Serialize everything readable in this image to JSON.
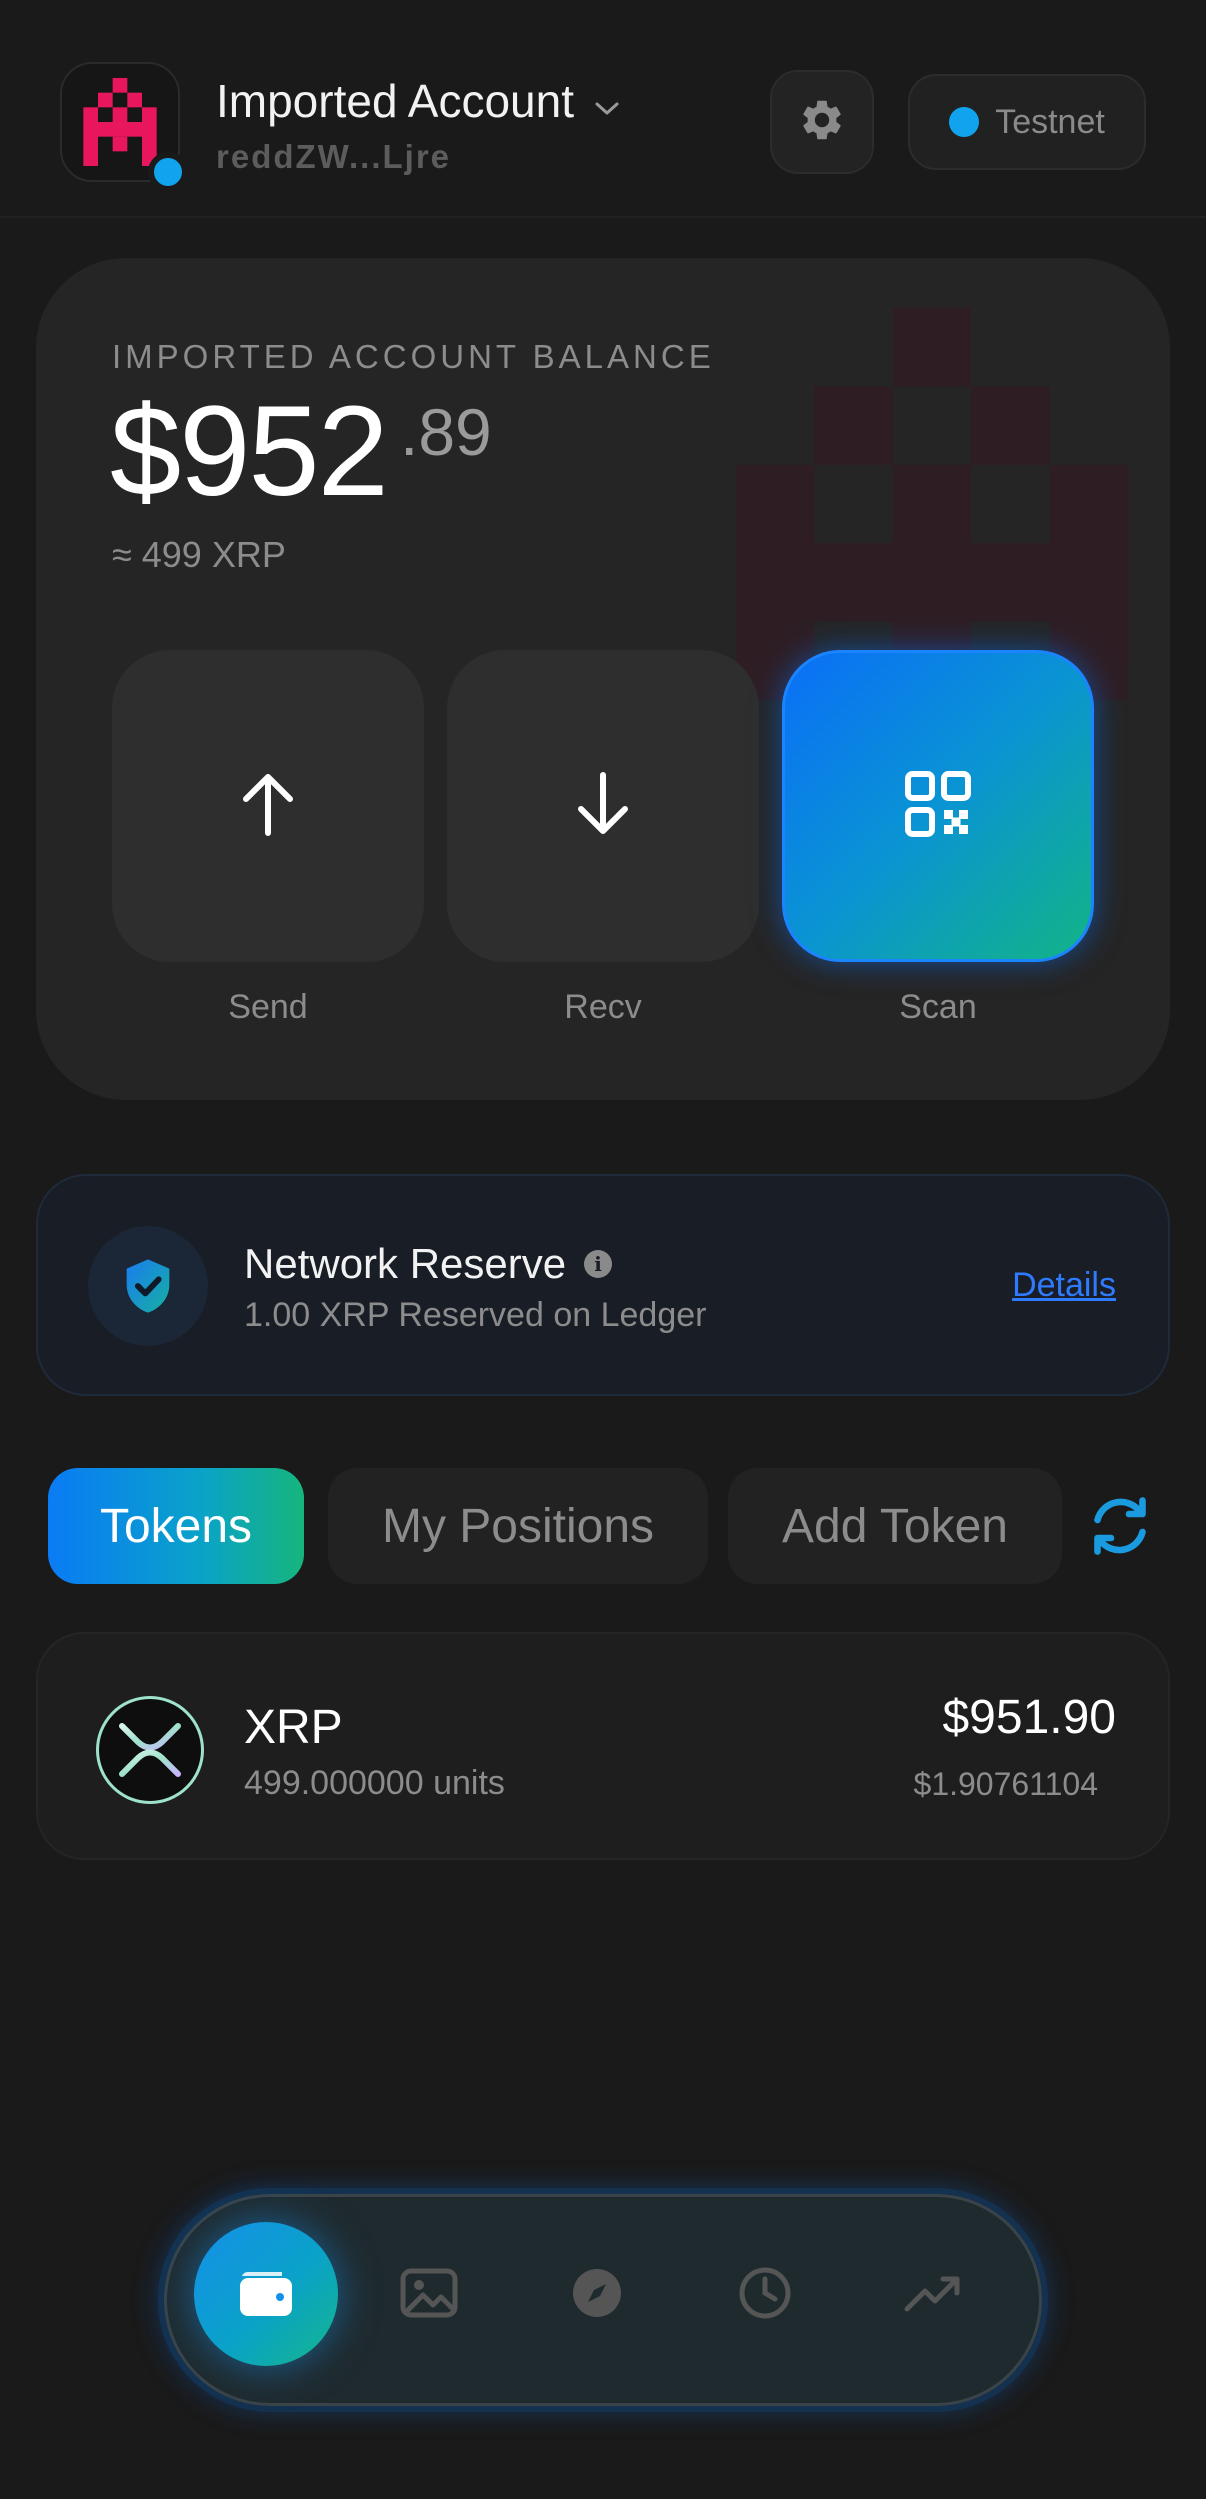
{
  "header": {
    "account_name": "Imported Account",
    "account_address": "reddZW...Ljre",
    "network_label": "Testnet",
    "icons": {
      "avatar": "pixel-logo-icon",
      "dropdown": "chevron-down-icon",
      "settings": "gear-icon"
    }
  },
  "balance": {
    "label": "IMPORTED ACCOUNT BALANCE",
    "amount_main": "$952",
    "amount_cents": ".89",
    "approx": "≈ 499 XRP"
  },
  "actions": [
    {
      "label": "Send",
      "icon": "arrow-up-icon"
    },
    {
      "label": "Recv",
      "icon": "arrow-down-icon"
    },
    {
      "label": "Scan",
      "icon": "qr-code-icon"
    }
  ],
  "reserve": {
    "title": "Network Reserve",
    "info_glyph": "i",
    "subtitle": "1.00 XRP Reserved on Ledger",
    "link": "Details"
  },
  "tabs": [
    {
      "label": "Tokens",
      "active": true
    },
    {
      "label": "My Positions",
      "active": false
    },
    {
      "label": "Add Token",
      "active": false
    }
  ],
  "tokens": [
    {
      "name": "XRP",
      "units": "499.000000 units",
      "value": "$951.90",
      "price": "$1.90761104"
    }
  ],
  "colors": {
    "accent_blue": "#0a7bf5",
    "accent_green": "#16b57d",
    "brand_pink": "#e8175d",
    "background": "#1a1a1a"
  }
}
